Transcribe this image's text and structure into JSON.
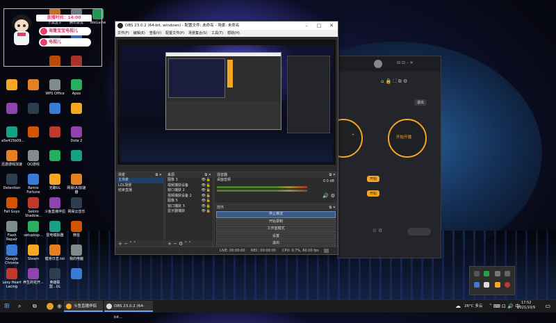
{
  "desktop": {
    "icons_col1": [
      "Microsoft Edge",
      "",
      "",
      "",
      "",
      "a5e415b09...",
      "迅游游戏加速",
      "Detention",
      "Fall Guys",
      "Flash Repair",
      "Google Chrome",
      "Lexy Heart Lacing"
    ],
    "icons_col2": [
      "Tricks Toward",
      "",
      "",
      "",
      "",
      "",
      "QQ游戏",
      "Remix Fortune",
      "Sekiro Shadow...",
      "setupksp...",
      "Steam",
      "养生的花开..."
    ],
    "icons_col3": [
      "小黑盒子",
      "",
      "",
      "WPS Office",
      "",
      "",
      "",
      "无聊UL",
      "斗鱼直播伴侣",
      "雷电模拟器",
      "健身日志.txt",
      "英雄联盟...UL"
    ],
    "icons_col4": [
      "腾讯会议",
      "",
      "",
      "Apex",
      "",
      "Dota 2",
      "",
      "网易UU加速器",
      "网易云音乐",
      "微信",
      "我的电脑",
      ""
    ],
    "icons_col5": [
      "WeGame",
      "",
      "",
      "",
      "",
      "",
      "",
      "",
      "",
      "",
      "",
      ""
    ]
  },
  "badge": {
    "time": "直播时间：14:00",
    "pill1": "海蓬宝宝电视儿",
    "pill2": "电视儿"
  },
  "obs": {
    "title": "OBS 23.0.2 (64-bit, windows) - 配置文件: 未命名 - 场景: 未命名",
    "menu": [
      "文件(F)",
      "编辑(E)",
      "查看(V)",
      "配置文件(P)",
      "场景集合(S)",
      "工具(T)",
      "帮助(H)"
    ],
    "docks": {
      "scenes": {
        "title": "场景",
        "items": [
          "主场景",
          "LOL场景",
          "结束直播"
        ]
      },
      "sources": {
        "title": "来源",
        "items": [
          "图像 3",
          "视频捕获设备",
          "窗口捕获 2",
          "视频捕获设备 2",
          "图像 5",
          "窗口捕获 3",
          "显示器捕获"
        ]
      },
      "mixer": {
        "title": "混音器",
        "channel": "桌面音频",
        "level": "0.0 dB"
      },
      "controls": {
        "title": "控件",
        "buttons": [
          "停止推流",
          "开始录制",
          "工作室模式",
          "设置",
          "退出"
        ]
      }
    },
    "status": {
      "live": "LIVE: 00:00:00",
      "rec": "REC: 00:00:00",
      "cpu": "CPU: 0.7%, 60.00 fps"
    }
  },
  "liveapp": {
    "exit_label": "退出",
    "start_label": "开始开播",
    "left_label": "开启",
    "btn1": "开始",
    "btn2": "开始"
  },
  "taskbar": {
    "tasks": [
      "斗鱼直播伴侣",
      "OBS 23.0.2 (64-bit..."
    ],
    "weather": "26°C 多云",
    "time": "17:52",
    "date": "2021/10/9"
  }
}
